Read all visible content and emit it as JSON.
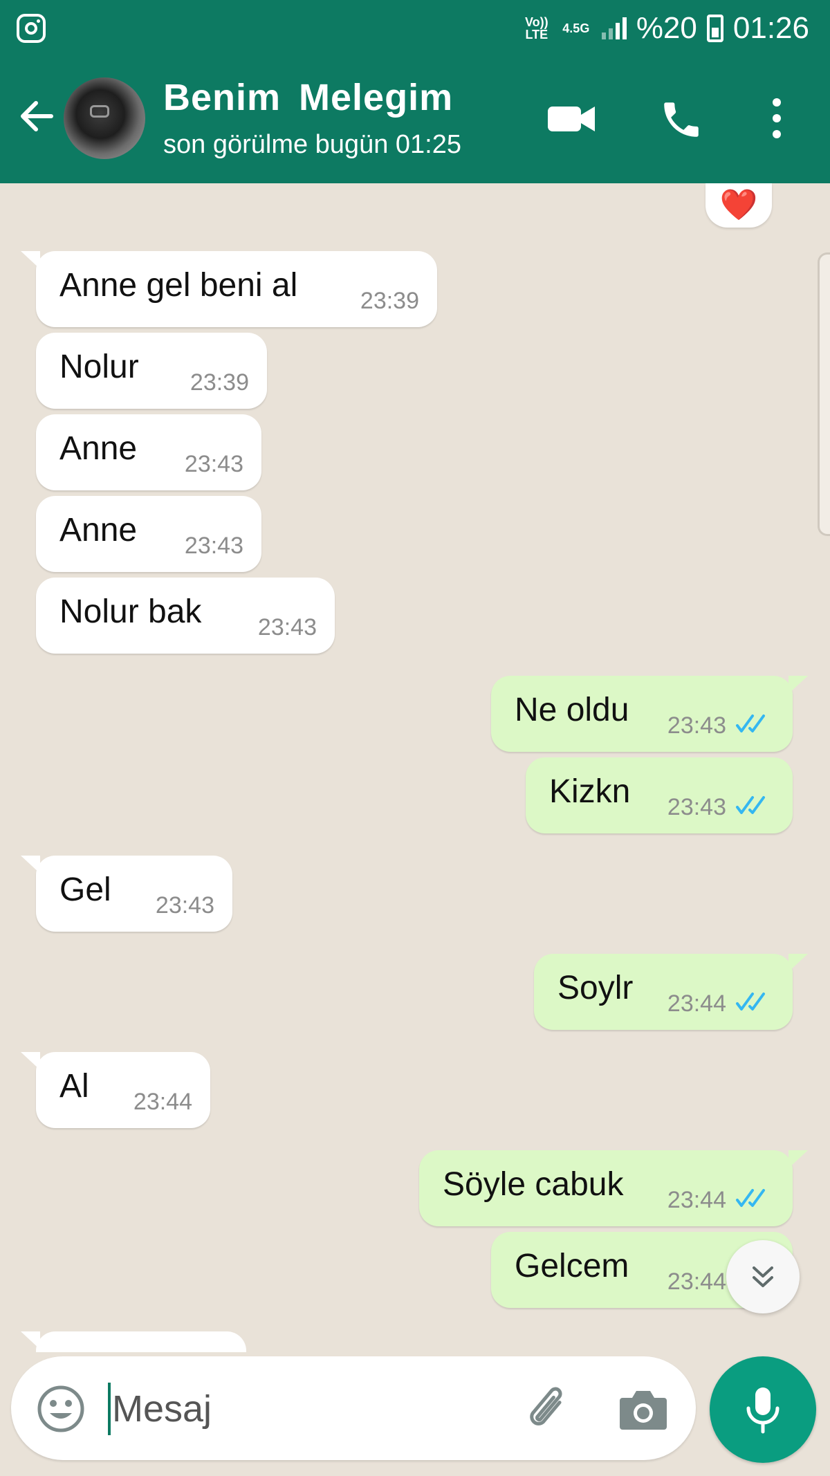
{
  "status_bar": {
    "volte": "Vo)) LTE",
    "network": "4.5G",
    "battery": "%20",
    "time": "01:26"
  },
  "header": {
    "contact_name": "Benim  Melegim",
    "last_seen": "son görülme bugün 01:25"
  },
  "reaction": {
    "emoji": "❤️"
  },
  "messages": [
    {
      "direction": "in",
      "text": "Anne gel beni al",
      "time": "23:39"
    },
    {
      "direction": "in",
      "text": "Nolur",
      "time": "23:39"
    },
    {
      "direction": "in",
      "text": "Anne",
      "time": "23:43"
    },
    {
      "direction": "in",
      "text": "Anne",
      "time": "23:43"
    },
    {
      "direction": "in",
      "text": "Nolur bak",
      "time": "23:43"
    },
    {
      "direction": "out",
      "text": "Ne oldu",
      "time": "23:43",
      "status": "read"
    },
    {
      "direction": "out",
      "text": "Kizkn",
      "time": "23:43",
      "status": "read"
    },
    {
      "direction": "in",
      "text": "Gel",
      "time": "23:43"
    },
    {
      "direction": "out",
      "text": "Soylr",
      "time": "23:44",
      "status": "read"
    },
    {
      "direction": "in",
      "text": "Al",
      "time": "23:44"
    },
    {
      "direction": "out",
      "text": "Söyle cabuk",
      "time": "23:44",
      "status": "read"
    },
    {
      "direction": "out",
      "text": "Gelcem",
      "time": "23:44",
      "status": "read"
    }
  ],
  "input": {
    "placeholder": "Mesaj"
  },
  "colors": {
    "header": "#0d7a62",
    "outgoing_bubble": "#dcf8c6",
    "incoming_bubble": "#ffffff",
    "chat_background": "#e9e2d8",
    "read_ticks": "#34b7f1",
    "mic_button": "#0a9d80"
  },
  "icons": [
    "instagram-icon",
    "back-arrow-icon",
    "video-call-icon",
    "voice-call-icon",
    "more-options-icon",
    "heart-icon",
    "double-check-icon",
    "scroll-down-icon",
    "emoji-icon",
    "attach-icon",
    "camera-icon",
    "mic-icon"
  ]
}
